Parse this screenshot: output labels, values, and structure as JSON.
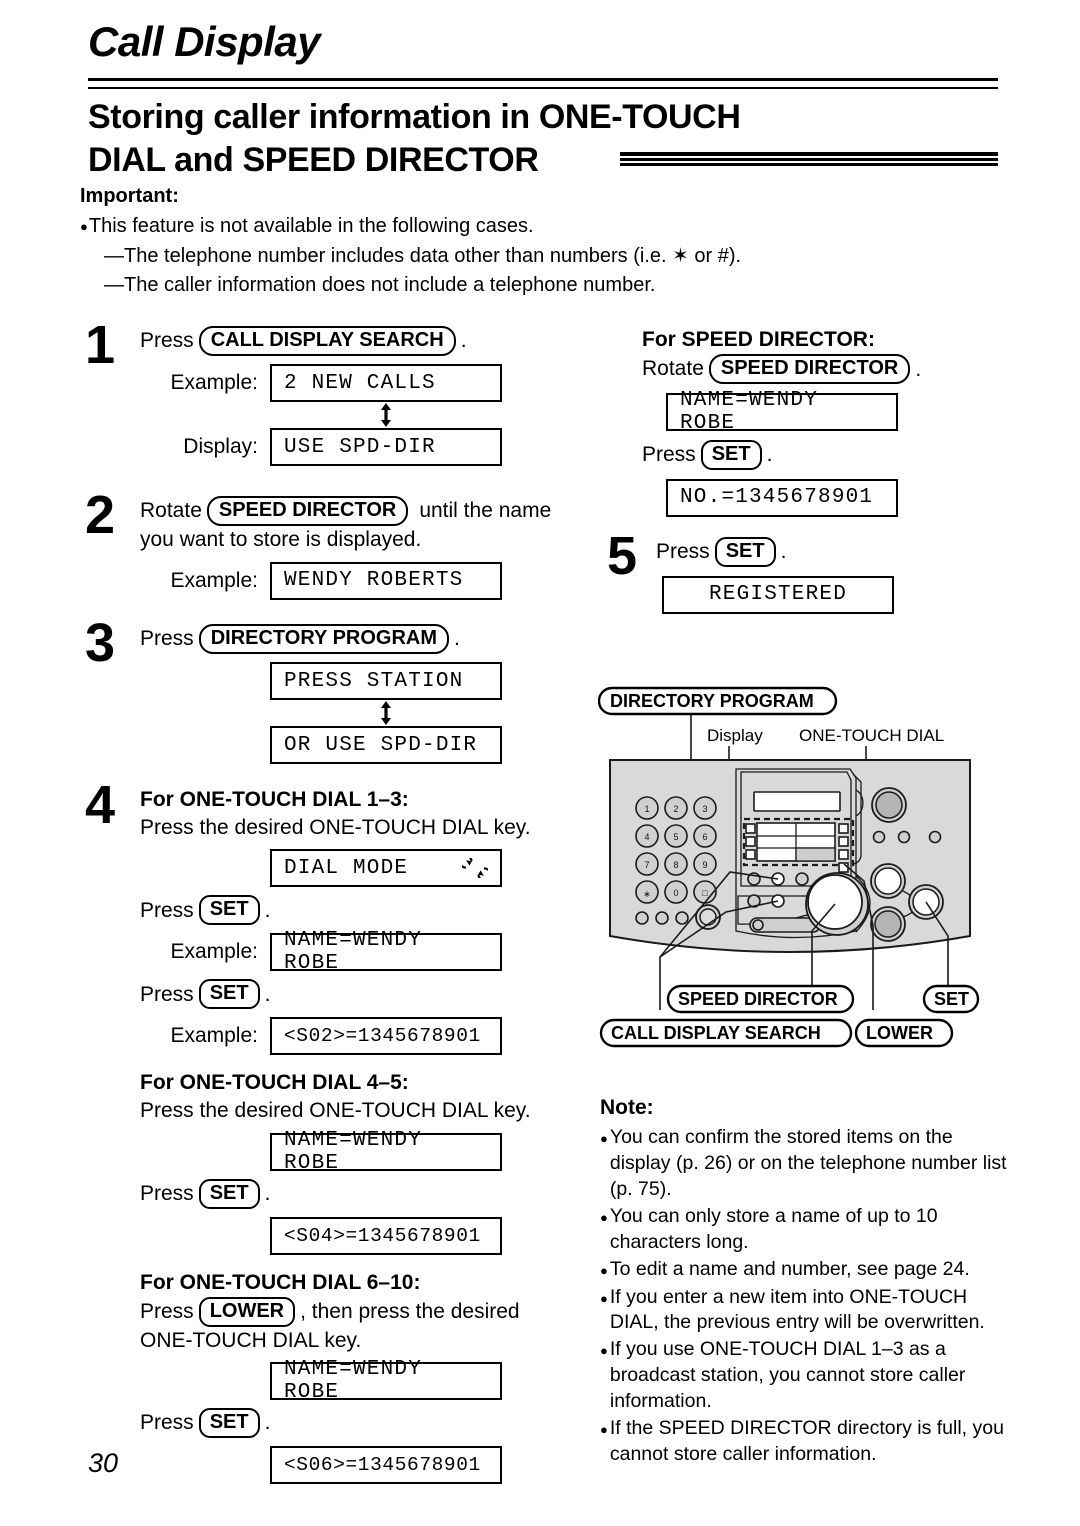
{
  "header": {
    "chapter": "Call Display",
    "section_line1": "Storing caller information in ONE-TOUCH",
    "section_line2": "DIAL and SPEED DIRECTOR"
  },
  "important": {
    "heading": "Important:",
    "bullet": "This feature is not available in the following cases.",
    "dash1": "—The telephone number includes data other than numbers (i.e. ✶ or #).",
    "dash2": "—The caller information does not include a telephone number."
  },
  "steps": {
    "s1": {
      "num": "1",
      "press_word": "Press",
      "key": "CALL DISPLAY SEARCH",
      "period": ".",
      "label_example": "Example:",
      "lcd_example": "2 NEW CALLS",
      "label_display": "Display:",
      "lcd_display": "USE SPD-DIR"
    },
    "s2": {
      "num": "2",
      "rotate_word": "Rotate",
      "key": "SPEED DIRECTOR",
      "tail1": "until the name",
      "tail2": "you want to store is displayed.",
      "label_example": "Example:",
      "lcd_example": "WENDY ROBERTS"
    },
    "s3": {
      "num": "3",
      "press_word": "Press",
      "key": "DIRECTORY PROGRAM",
      "period": ".",
      "lcd_a": "PRESS STATION",
      "lcd_b": "OR USE SPD-DIR"
    },
    "s4": {
      "num": "4",
      "sub1_title": "For ONE-TOUCH DIAL 1–3:",
      "sub1_text": "Press the desired ONE-TOUCH DIAL key.",
      "lcd_dial_mode": "DIAL MODE",
      "lcd_dial_mode_icon": "rotate-cycle-icon",
      "press_set_1": "Press",
      "key_set": "SET",
      "period": ".",
      "label_example_1": "Example:",
      "lcd_name_1": "NAME=WENDY ROBE",
      "press_set_2": "Press",
      "label_example_2": "Example:",
      "lcd_num_1": "<S02>=1345678901",
      "sub2_title": "For ONE-TOUCH DIAL 4–5:",
      "sub2_text": "Press the desired ONE-TOUCH DIAL key.",
      "lcd_name_2": "NAME=WENDY ROBE",
      "press_set_3": "Press",
      "lcd_num_2": "<S04>=1345678901",
      "sub3_title": "For ONE-TOUCH DIAL 6–10:",
      "sub3_text_a": "Press",
      "key_lower": "LOWER",
      "sub3_text_b": ", then press the desired",
      "sub3_text_c": "ONE-TOUCH DIAL key.",
      "lcd_name_3": "NAME=WENDY ROBE",
      "press_set_4": "Press",
      "lcd_num_3": "<S06>=1345678901"
    },
    "s4r": {
      "title": "For SPEED DIRECTOR:",
      "rotate_word": "Rotate",
      "key": "SPEED DIRECTOR",
      "period": ".",
      "lcd_name": "NAME=WENDY ROBE",
      "press_word": "Press",
      "key_set": "SET",
      "lcd_no": "NO.=1345678901"
    },
    "s5": {
      "num": "5",
      "press_word": "Press",
      "key_set": "SET",
      "period": ".",
      "lcd_registered": "REGISTERED"
    }
  },
  "diagram": {
    "label_directory_program": "DIRECTORY PROGRAM",
    "label_display": "Display",
    "label_one_touch_dial": "ONE-TOUCH DIAL",
    "label_speed_director": "SPEED DIRECTOR",
    "label_set": "SET",
    "label_call_display_search": "CALL DISPLAY SEARCH",
    "label_lower": "LOWER",
    "keypad": [
      "1",
      "2",
      "3",
      "4",
      "5",
      "6",
      "7",
      "8",
      "9",
      "∗",
      "0",
      "□"
    ],
    "body_color": "#d9d9d9",
    "outline_color": "#1a1a1a"
  },
  "note": {
    "heading": "Note:",
    "items": [
      "You can confirm the stored items on the display (p. 26) or on the telephone number list (p. 75).",
      "You can only store a name of up to 10 characters long.",
      "To edit a name and number, see page 24.",
      "If you enter a new item into ONE-TOUCH DIAL, the previous entry will be overwritten.",
      "If you use ONE-TOUCH DIAL 1–3 as a broadcast station, you cannot store caller information.",
      "If the SPEED DIRECTOR directory is full, you cannot store caller information."
    ]
  },
  "footer": {
    "page_number": "30"
  }
}
